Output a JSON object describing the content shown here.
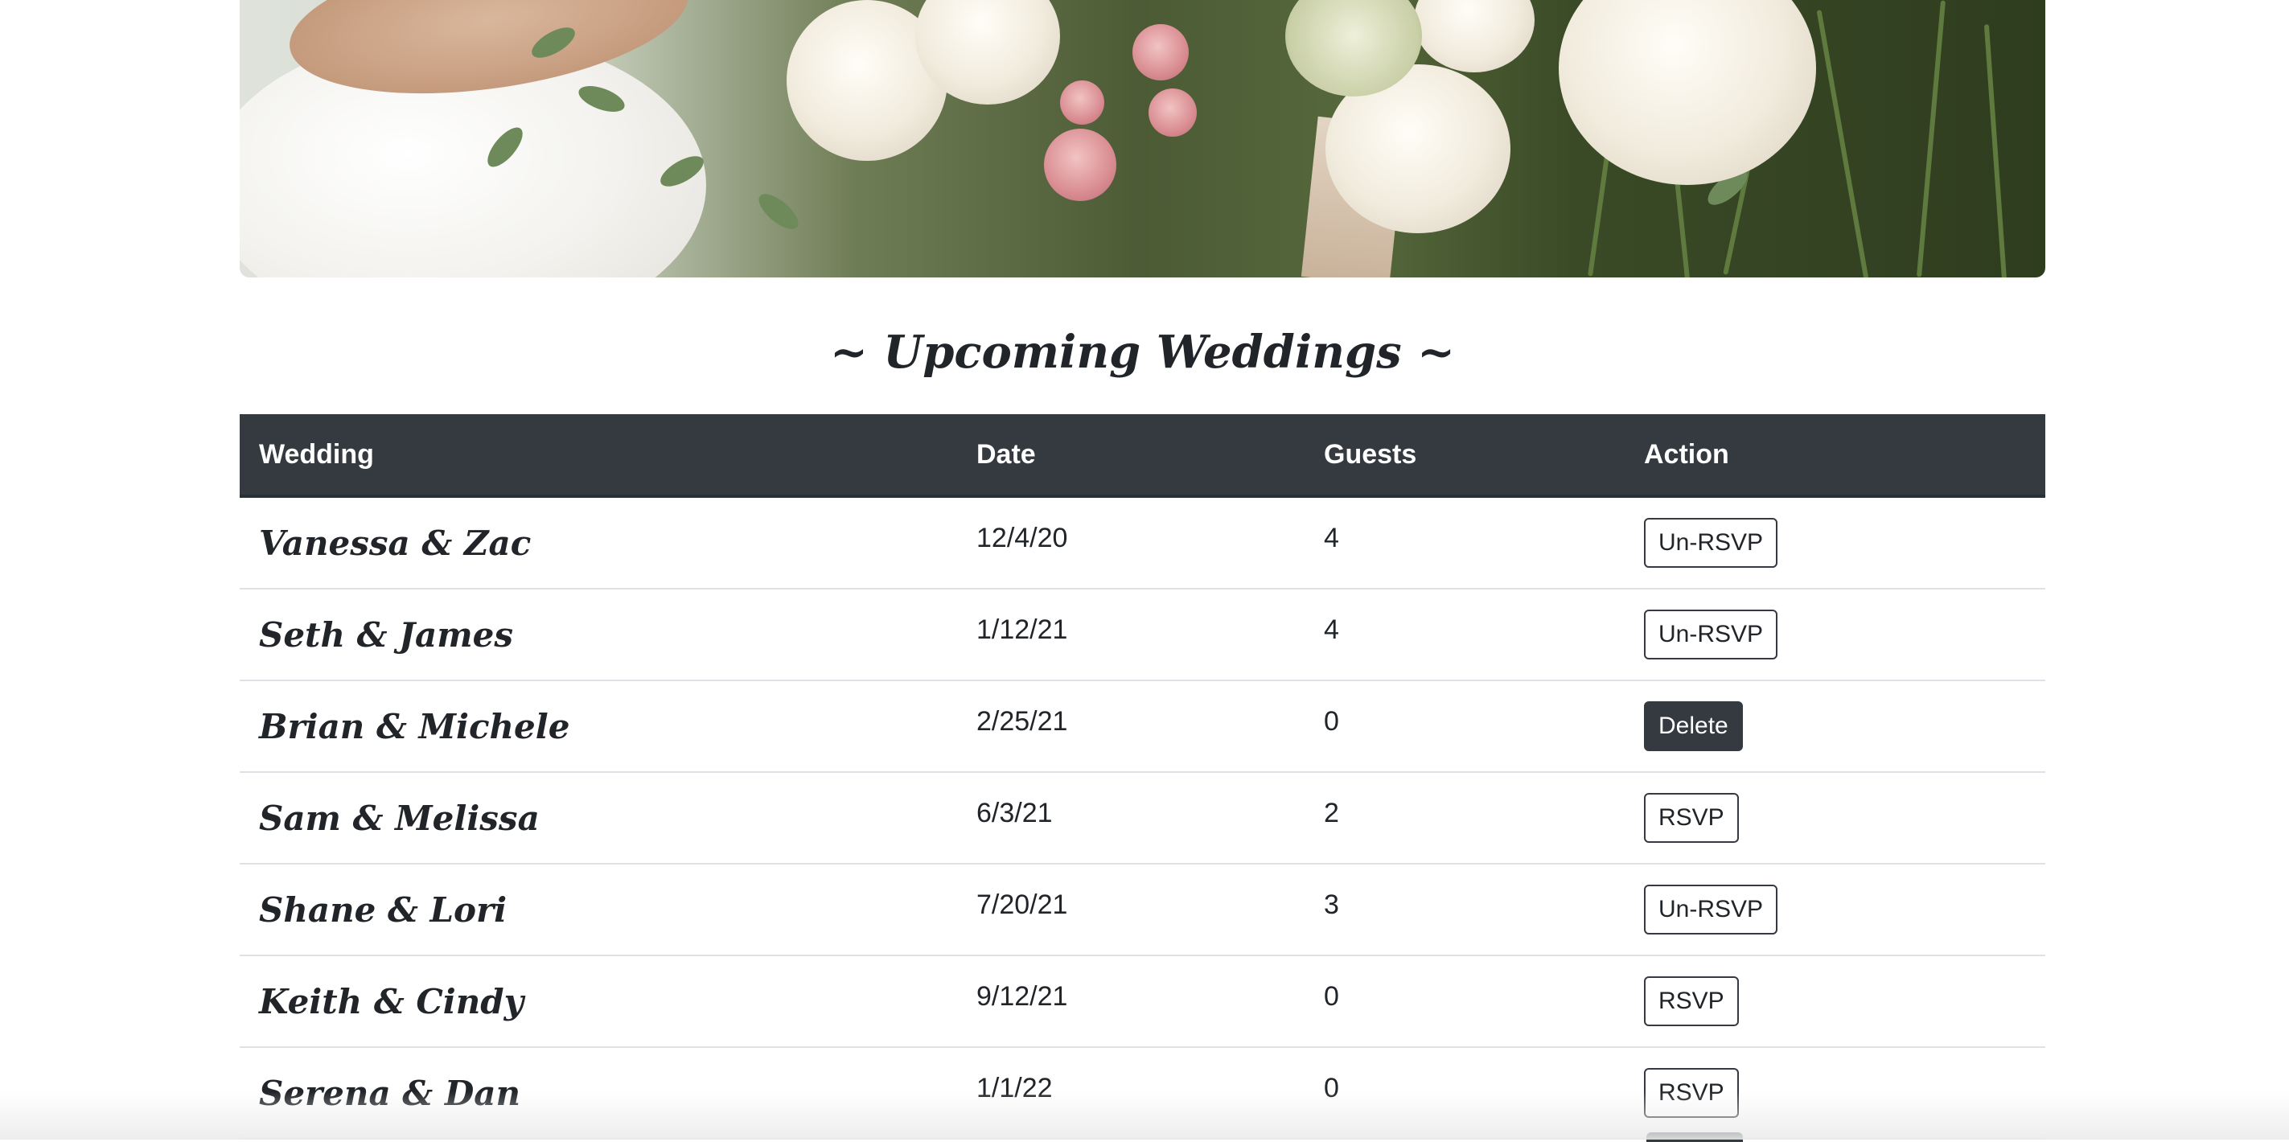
{
  "hero": {
    "image_name": "bridal-bouquet-photo"
  },
  "heading": "~ Upcoming Weddings ~",
  "table": {
    "columns": [
      "Wedding",
      "Date",
      "Guests",
      "Action"
    ],
    "rows": [
      {
        "wedding": "Vanessa & Zac",
        "date": "12/4/20",
        "guests": "4",
        "action": "Un-RSVP",
        "style": "outline"
      },
      {
        "wedding": "Seth & James",
        "date": "1/12/21",
        "guests": "4",
        "action": "Un-RSVP",
        "style": "outline"
      },
      {
        "wedding": "Brian & Michele",
        "date": "2/25/21",
        "guests": "0",
        "action": "Delete",
        "style": "dark"
      },
      {
        "wedding": "Sam & Melissa",
        "date": "6/3/21",
        "guests": "2",
        "action": "RSVP",
        "style": "outline"
      },
      {
        "wedding": "Shane & Lori",
        "date": "7/20/21",
        "guests": "3",
        "action": "Un-RSVP",
        "style": "outline"
      },
      {
        "wedding": "Keith & Cindy",
        "date": "9/12/21",
        "guests": "0",
        "action": "RSVP",
        "style": "outline"
      },
      {
        "wedding": "Serena & Dan",
        "date": "1/1/22",
        "guests": "0",
        "action": "RSVP",
        "style": "outline"
      }
    ]
  },
  "colors": {
    "header_bg": "#343a40",
    "header_text": "#ffffff",
    "row_border": "#dee2e6"
  }
}
